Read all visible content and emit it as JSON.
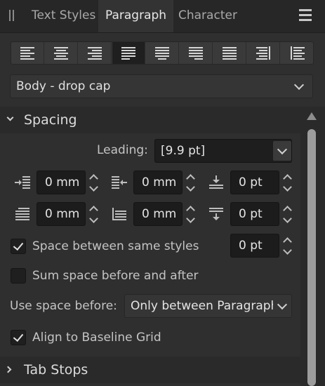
{
  "tabs": [
    "Text Styles",
    "Paragraph",
    "Character"
  ],
  "active_tab": "Paragraph",
  "alignment_buttons": [
    "align-left-icon",
    "align-center-icon",
    "align-right-icon",
    "justify-left-icon",
    "justify-center-icon",
    "justify-right-icon",
    "justify-all-icon",
    "align-towards-spine-icon",
    "align-away-from-spine-icon"
  ],
  "selected_alignment": "justify-left-icon",
  "paragraph_style": "Body - drop cap",
  "spacing": {
    "title": "Spacing",
    "leading_label": "Leading:",
    "leading_value": "[9.9 pt]",
    "left_indent": "0 mm",
    "first_line_indent": "0 mm",
    "space_before": "0 pt",
    "right_indent": "0 mm",
    "last_line_indent": "0 mm",
    "space_after": "0 pt",
    "same_styles_label": "Space between same styles",
    "same_styles_checked": true,
    "same_styles_value": "0 pt",
    "sum_space_label": "Sum space before and after",
    "sum_space_checked": false,
    "use_space_before_label": "Use space before:",
    "use_space_before_value": "Only between Paragraphs",
    "baseline_label": "Align to Baseline Grid",
    "baseline_checked": true
  },
  "tab_stops": {
    "title": "Tab Stops"
  }
}
